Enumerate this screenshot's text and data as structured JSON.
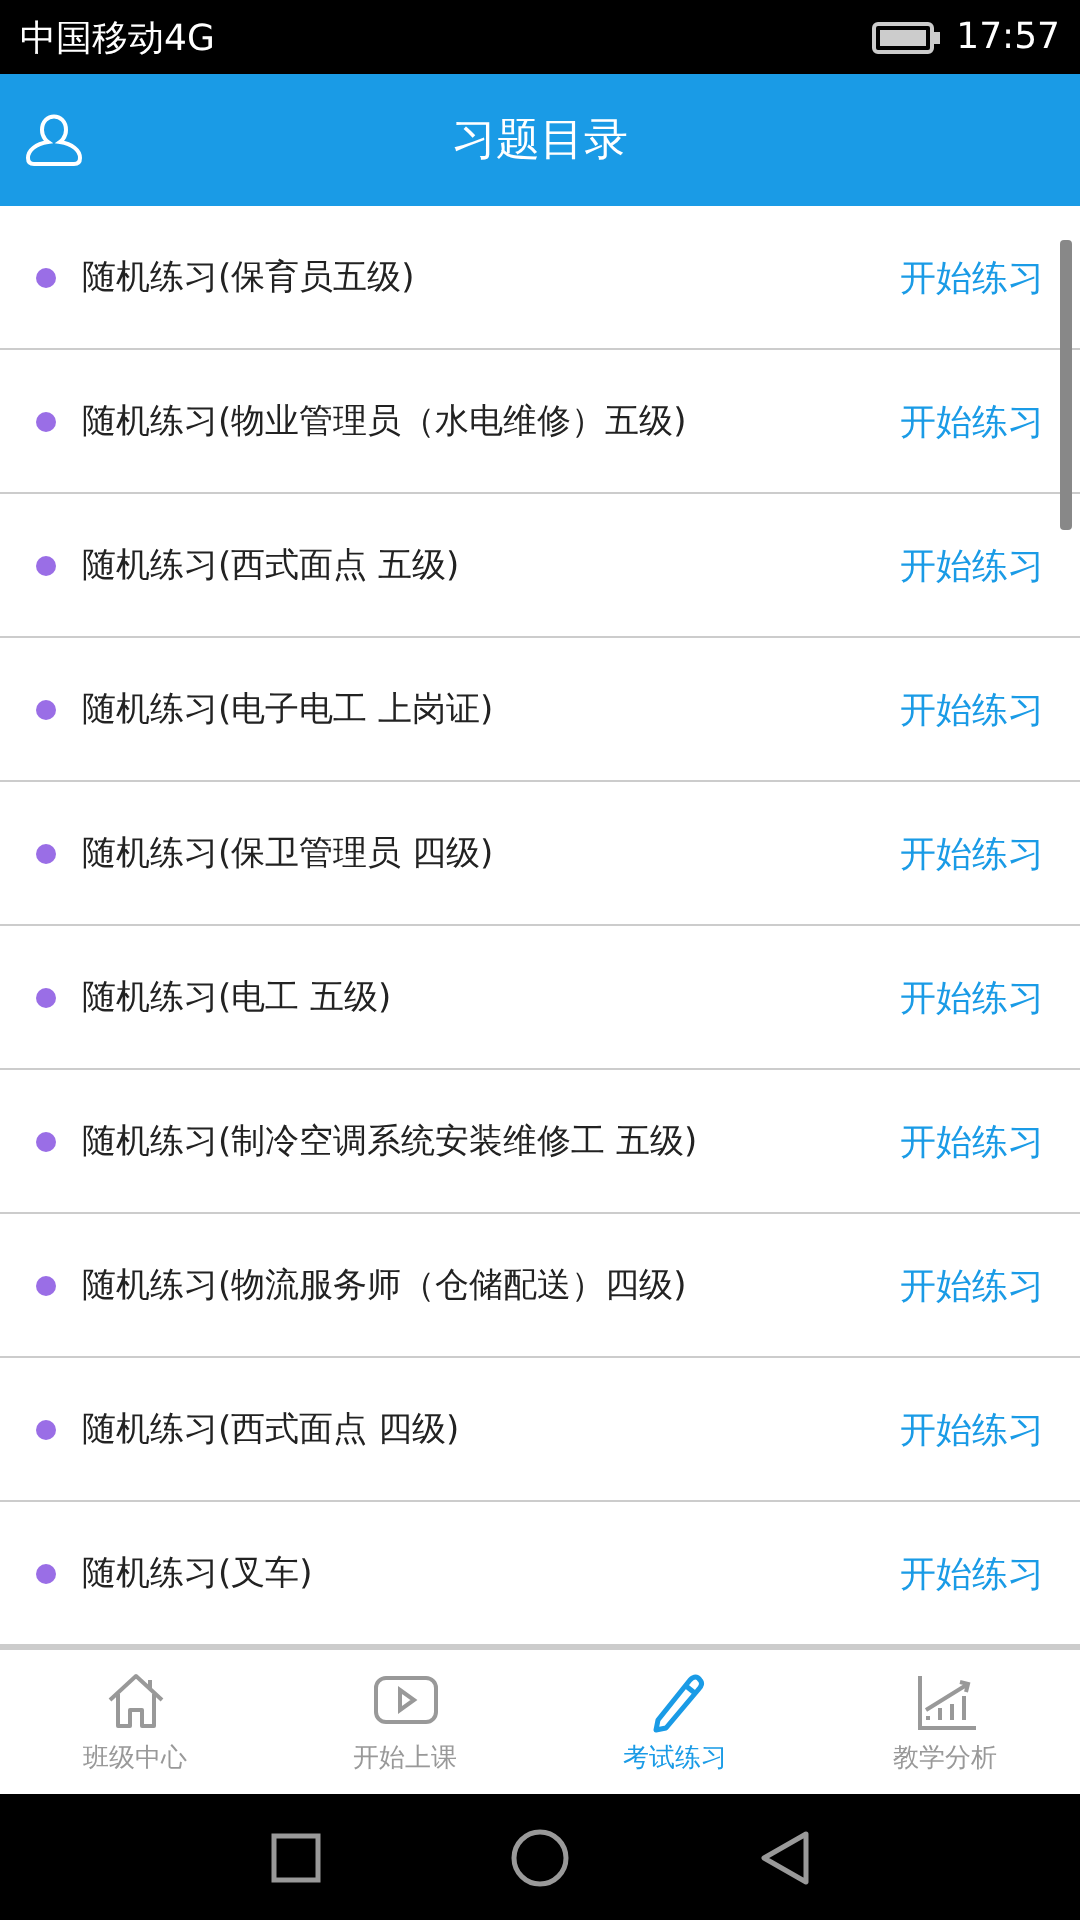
{
  "status_bar": {
    "carrier": "中国移动4G",
    "time": "17:57"
  },
  "header": {
    "title": "习题目录"
  },
  "exercises": [
    {
      "name": "随机练习(保育员五级)",
      "action": "开始练习"
    },
    {
      "name": "随机练习(物业管理员（水电维修）五级)",
      "action": "开始练习"
    },
    {
      "name": "随机练习(西式面点 五级)",
      "action": "开始练习"
    },
    {
      "name": "随机练习(电子电工 上岗证)",
      "action": "开始练习"
    },
    {
      "name": "随机练习(保卫管理员 四级)",
      "action": "开始练习"
    },
    {
      "name": "随机练习(电工 五级)",
      "action": "开始练习"
    },
    {
      "name": "随机练习(制冷空调系统安装维修工 五级)",
      "action": "开始练习"
    },
    {
      "name": "随机练习(物流服务师（仓储配送）四级)",
      "action": "开始练习"
    },
    {
      "name": "随机练习(西式面点 四级)",
      "action": "开始练习"
    },
    {
      "name": "随机练习(叉车)",
      "action": "开始练习"
    }
  ],
  "tabs": [
    {
      "label": "班级中心",
      "selected": false
    },
    {
      "label": "开始上课",
      "selected": false
    },
    {
      "label": "考试练习",
      "selected": true
    },
    {
      "label": "教学分析",
      "selected": false
    }
  ]
}
